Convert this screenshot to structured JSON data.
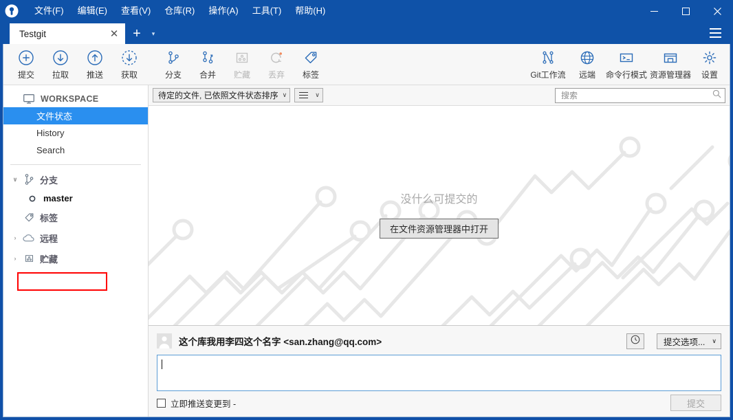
{
  "window": {
    "title": "Testgit",
    "app_icon": "sourcetree-logo-icon",
    "controls": {
      "minimize": "─",
      "maximize": "☐",
      "close": "✕"
    }
  },
  "menubar": {
    "items": [
      {
        "label": "文件(F)",
        "name": "menu-file"
      },
      {
        "label": "编辑(E)",
        "name": "menu-edit"
      },
      {
        "label": "查看(V)",
        "name": "menu-view"
      },
      {
        "label": "仓库(R)",
        "name": "menu-repository"
      },
      {
        "label": "操作(A)",
        "name": "menu-actions"
      },
      {
        "label": "工具(T)",
        "name": "menu-tools"
      },
      {
        "label": "帮助(H)",
        "name": "menu-help"
      }
    ]
  },
  "tabs": {
    "active": "Testgit",
    "close_glyph": "✕",
    "add_glyph": "+",
    "caret_glyph": "▾"
  },
  "toolbar": {
    "left": [
      {
        "label": "提交",
        "icon": "commit-plus-icon",
        "disabled": false
      },
      {
        "label": "拉取",
        "icon": "pull-down-arrow-icon",
        "disabled": false
      },
      {
        "label": "推送",
        "icon": "push-up-arrow-icon",
        "disabled": false
      },
      {
        "label": "获取",
        "icon": "fetch-dashed-arrow-icon",
        "disabled": false
      },
      {
        "label": "分支",
        "icon": "branch-icon",
        "disabled": false
      },
      {
        "label": "合并",
        "icon": "merge-icon",
        "disabled": false
      },
      {
        "label": "贮藏",
        "icon": "stash-icon",
        "disabled": true
      },
      {
        "label": "丢弃",
        "icon": "discard-refresh-icon",
        "disabled": true
      },
      {
        "label": "标签",
        "icon": "tag-icon",
        "disabled": false
      }
    ],
    "right": [
      {
        "label": "Git工作流",
        "icon": "gitflow-icon",
        "disabled": false
      },
      {
        "label": "远端",
        "icon": "globe-icon",
        "disabled": false
      },
      {
        "label": "命令行模式",
        "icon": "terminal-icon",
        "disabled": false
      },
      {
        "label": "资源管理器",
        "icon": "explorer-folder-icon",
        "disabled": false
      },
      {
        "label": "设置",
        "icon": "gear-icon",
        "disabled": false
      }
    ]
  },
  "sidebar": {
    "workspace": {
      "label": "WORKSPACE",
      "icon": "monitor-icon"
    },
    "workspace_items": [
      {
        "label": "文件状态",
        "name": "sidebar-item-file-status",
        "selected": true
      },
      {
        "label": "History",
        "name": "sidebar-item-history",
        "selected": false
      },
      {
        "label": "Search",
        "name": "sidebar-item-search",
        "selected": false
      }
    ],
    "groups": [
      {
        "label": "分支",
        "name": "sidebar-group-branches",
        "icon": "branch-icon",
        "caret": "∨",
        "expanded": true,
        "children": [
          {
            "label": "master",
            "name": "sidebar-branch-master",
            "icon": "branch-dot-icon",
            "highlighted": true
          }
        ]
      },
      {
        "label": "标签",
        "name": "sidebar-group-tags",
        "icon": "tag-icon",
        "caret": "",
        "expanded": false,
        "children": []
      },
      {
        "label": "远程",
        "name": "sidebar-group-remotes",
        "icon": "cloud-icon",
        "caret": "›",
        "expanded": false,
        "children": []
      },
      {
        "label": "贮藏",
        "name": "sidebar-group-stashes",
        "icon": "stash-icon",
        "caret": "›",
        "expanded": false,
        "children": []
      }
    ]
  },
  "filterbar": {
    "sort_combo": {
      "value": "待定的文件, 已依照文件状态排序",
      "caret": "∨"
    },
    "view_combo": {
      "icon": "list-lines-icon",
      "caret": "∨"
    },
    "search": {
      "placeholder": "搜索",
      "value": "",
      "icon": "search-icon"
    }
  },
  "empty_state": {
    "message": "没什么可提交的",
    "button_label": "在文件资源管理器中打开"
  },
  "commit_panel": {
    "avatar": "user-avatar",
    "author": "这个库我用李四这个名字 <san.zhang@qq.com>",
    "history_button_icon": "clock-icon",
    "options_combo": {
      "label": "提交选项...",
      "caret": "∨"
    },
    "message": {
      "value": "",
      "focused": true
    },
    "push_checkbox": {
      "label": "立即推送变更到 -",
      "checked": false
    },
    "commit_button": {
      "label": "提交",
      "disabled": true
    }
  },
  "colors": {
    "title_blue": "#0f52a8",
    "accent_blue": "#2a8fef",
    "icon_blue": "#2b6cb8",
    "highlight_red": "#ff0000",
    "pattern_gray": "#e6e6e6"
  }
}
